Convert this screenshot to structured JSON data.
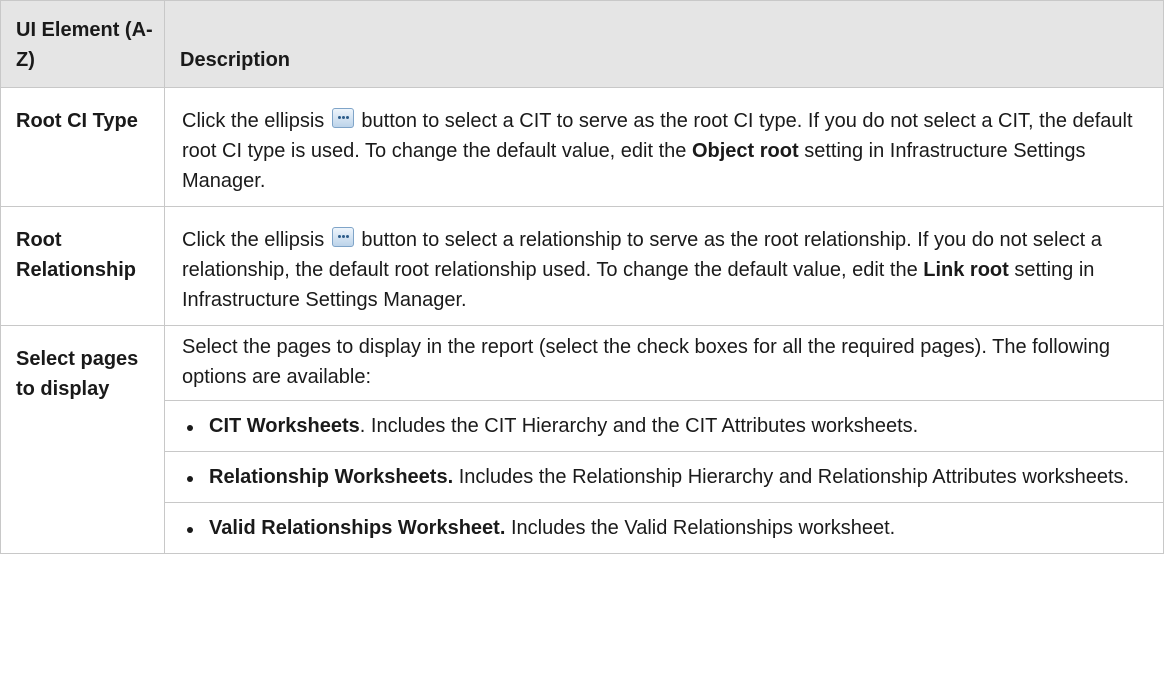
{
  "header": {
    "col1": "UI Element (A-Z)",
    "col2": "Description"
  },
  "rows": [
    {
      "name": "Root CI Type",
      "before_icon": "Click the ellipsis",
      "after_icon": "button to select a CIT to serve as the root CI type. If you do not select a CIT, the default root CI type is used. To change the default value, edit the",
      "bold_term": "Object root",
      "tail": "setting in Infrastructure Settings Manager."
    },
    {
      "name": "Root Relationship",
      "before_icon": "Click the ellipsis",
      "after_icon": "button to select a relationship to serve as the root relationship. If you do not select a relationship, the default root relationship used. To change the default value, edit the",
      "bold_term": "Link root",
      "tail": "setting in Infrastructure Settings Manager."
    },
    {
      "name": "Select pages to display",
      "intro": "Select the pages to display in the report (select the check boxes for all the required pages). The following options are available:",
      "options": [
        {
          "term": "CIT Worksheets",
          "sep": ".",
          "text": " Includes the CIT Hierarchy and the CIT Attributes worksheets."
        },
        {
          "term": "Relationship Worksheets.",
          "sep": "",
          "text": " Includes the Relationship Hierarchy and Relationship Attributes worksheets."
        },
        {
          "term": "Valid Relationships Worksheet.",
          "sep": "",
          "text": " Includes the Valid Relationships worksheet."
        }
      ]
    }
  ],
  "icons": {
    "ellipsis": "ellipsis-button-icon"
  }
}
